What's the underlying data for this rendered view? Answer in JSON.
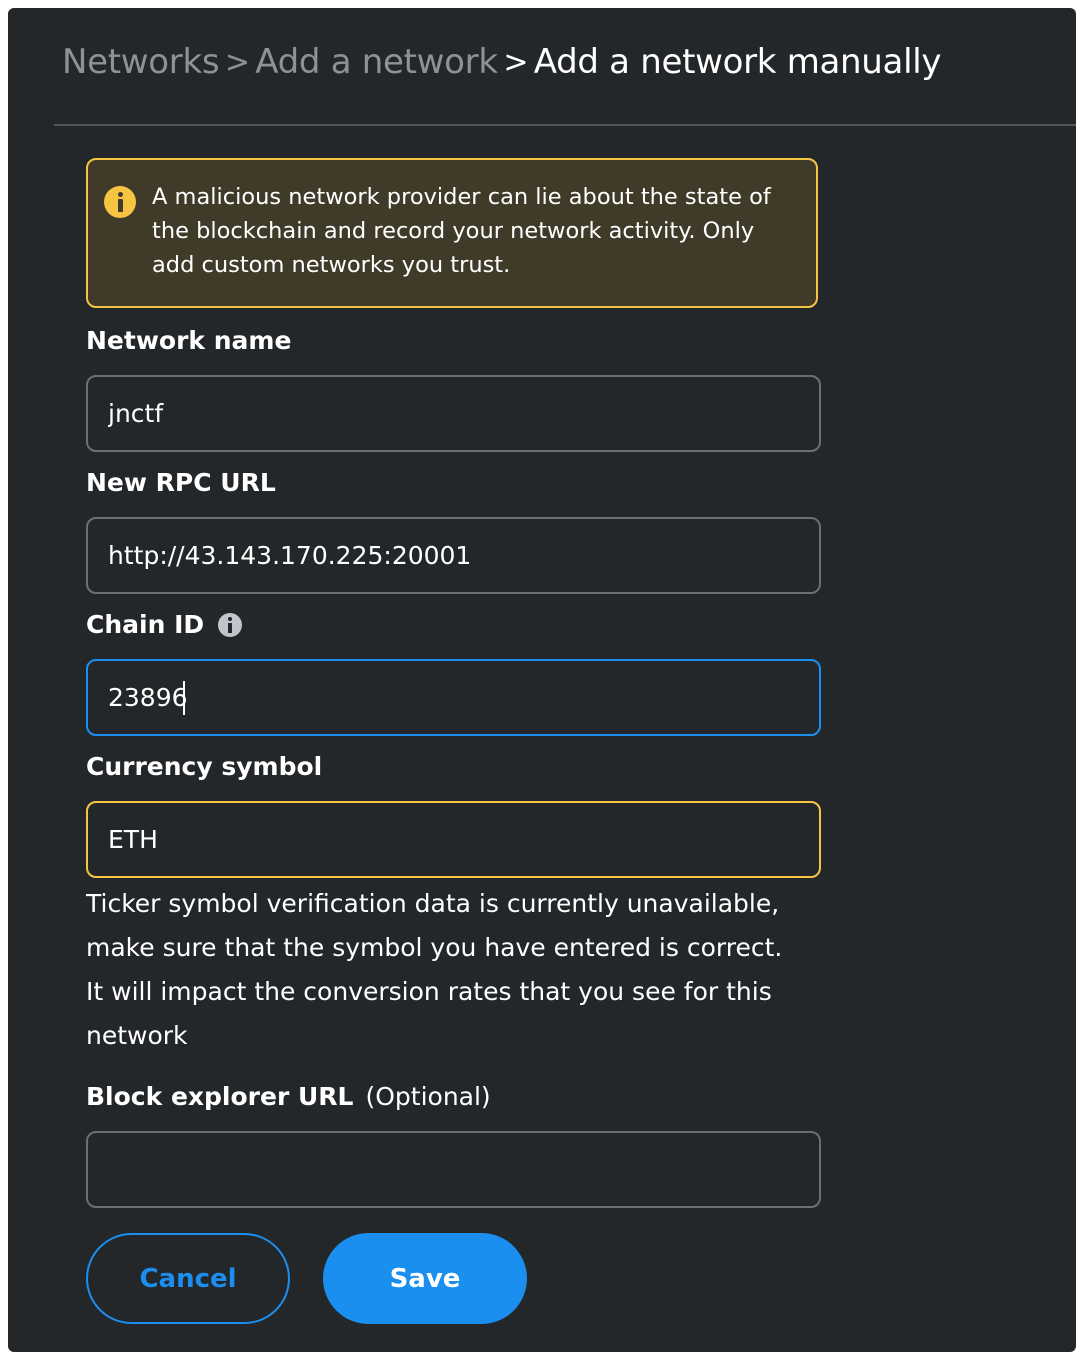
{
  "breadcrumb": {
    "items": [
      "Networks",
      "Add a network",
      "Add a network manually"
    ],
    "separator": ">"
  },
  "warning": {
    "icon": "info-circle-icon",
    "text": "A malicious network provider can lie about the state of the blockchain and record your network activity. Only add custom networks you trust."
  },
  "form": {
    "network_name": {
      "label": "Network name",
      "value": "jnctf"
    },
    "rpc_url": {
      "label": "New RPC URL",
      "value": "http://43.143.170.225:20001"
    },
    "chain_id": {
      "label": "Chain ID",
      "value": "23896",
      "icon": "info-icon"
    },
    "currency_symbol": {
      "label": "Currency symbol",
      "value": "ETH",
      "helper": "Ticker symbol verification data is currently unavailable, make sure that the symbol you have entered is correct. It will impact the conversion rates that you see for this network"
    },
    "block_explorer": {
      "label": "Block explorer URL",
      "optional": "(Optional)",
      "value": ""
    }
  },
  "actions": {
    "cancel": "Cancel",
    "save": "Save"
  },
  "colors": {
    "background": "#24272a",
    "accent": "#1a8ff0",
    "warning": "#f6c343",
    "warning_bg": "#403b29",
    "text": "#ffffff",
    "muted": "#8d9298"
  }
}
